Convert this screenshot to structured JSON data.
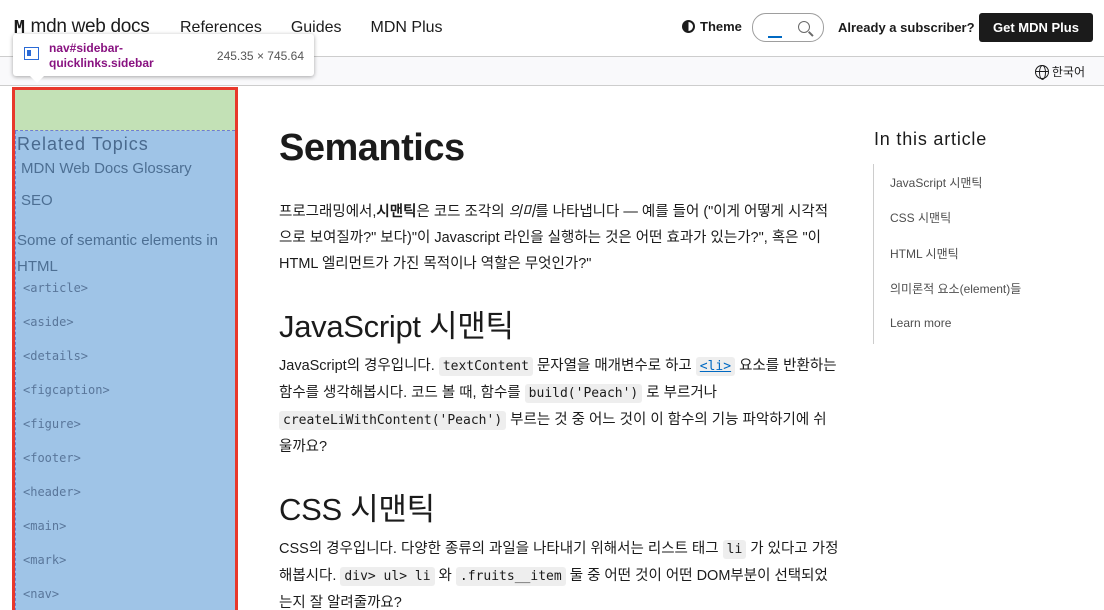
{
  "header": {
    "logo": "mdn web docs",
    "nav": [
      "References",
      "Guides",
      "MDN Plus"
    ],
    "theme_label": "Theme",
    "subscriber_text": "Already a subscriber?",
    "get_plus_label": "Get MDN Plus"
  },
  "toolbar": {
    "language": "한국어"
  },
  "devtools_tooltip": {
    "selector": "nav#sidebar-quicklinks.sidebar",
    "size": "245.35 × 745.64"
  },
  "sidebar": {
    "title": "Related Topics",
    "links": [
      "MDN Web Docs Glossary",
      "SEO",
      "Some of semantic elements in HTML"
    ],
    "elements": [
      "<article>",
      "<aside>",
      "<details>",
      "<figcaption>",
      "<figure>",
      "<footer>",
      "<header>",
      "<main>",
      "<mark>",
      "<nav>"
    ]
  },
  "article": {
    "title": "Semantics",
    "intro": {
      "p1": "프로그래밍에서,",
      "bold": "시맨틱",
      "p2": "은 코드 조각의 ",
      "em": "의미",
      "p3": "를 나타냅니다 — 예를 들어 (\"이게 어떻게 시각적으로 보여질까?\" 보다)\"이 Javascript 라인을 실행하는 것은 어떤 효과가 있는가?\", 혹은 \"이 HTML 엘리먼트가 가진 목적이나 역할은 무엇인가?\""
    },
    "js_heading": "JavaScript 시맨틱",
    "js": {
      "t1": "JavaScript의 경우입니다. ",
      "c1": "textContent",
      "t2": " 문자열을 매개변수로 하고 ",
      "c2": "<li>",
      "t3": " 요소를 반환하는 함수를 생각해봅시다. 코드 볼 때, 함수를 ",
      "c3": "build('Peach')",
      "t4": " 로 부르거나 ",
      "c4": "createLiWithContent('Peach')",
      "t5": " 부르는 것 중 어느 것이 이 함수의 기능 파악하기에 쉬울까요?"
    },
    "css_heading": "CSS 시맨틱",
    "css": {
      "t1": "CSS의 경우입니다. 다양한 종류의 과일을 나타내기 위해서는 리스트 태그 ",
      "c1": "li",
      "t2": " 가 있다고 가정해봅시다. ",
      "c2": "div> ul> li",
      "t3": " 와 ",
      "c3": ".fruits__item",
      "t4": " 둘 중 어떤 것이 어떤 DOM부분이 선택되었는지 잘 알려줄까요?"
    }
  },
  "toc": {
    "title": "In this article",
    "items": [
      "JavaScript 시맨틱",
      "CSS 시맨틱",
      "HTML 시맨틱",
      "의미론적 요소(element)들",
      "Learn more"
    ]
  },
  "colors": {
    "sidebar_highlight": "#9fc4e7",
    "padding_highlight": "#c3e1b6",
    "outline": "#e8382b",
    "link": "#0069c2"
  }
}
